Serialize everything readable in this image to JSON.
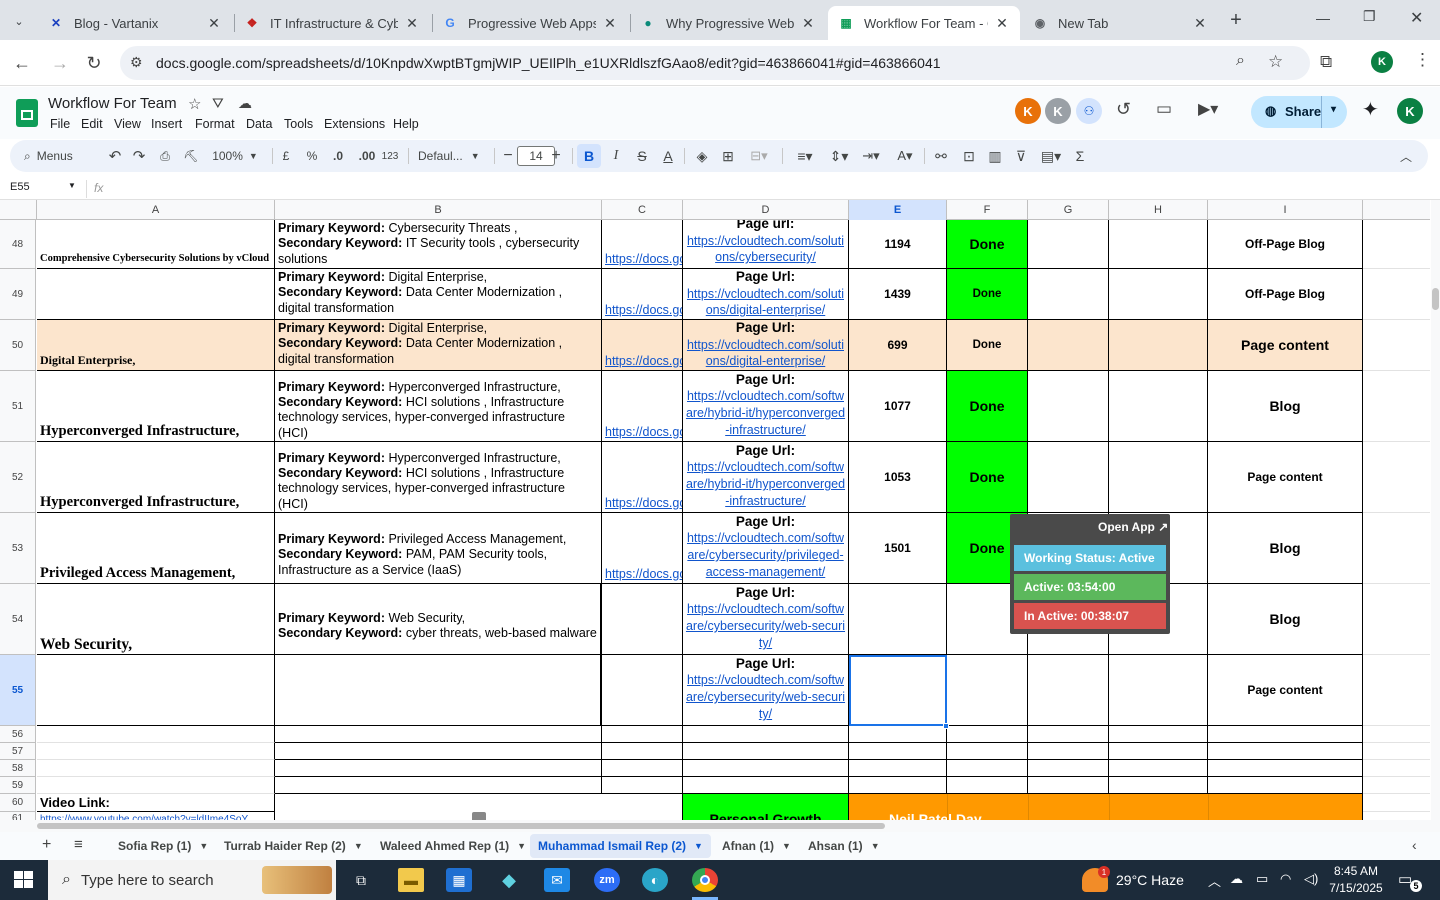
{
  "browser": {
    "tabs": [
      {
        "title": "Blog - Vartanix",
        "icon": "vartanix-x-icon",
        "color": "#1a3fbf",
        "glyph": "✕",
        "active": false
      },
      {
        "title": "IT Infrastructure & Cybe",
        "icon": "site-icon",
        "color": "#c5221f",
        "glyph": "❖",
        "active": false
      },
      {
        "title": "Progressive Web Apps (",
        "icon": "google-icon",
        "color": "#4285f4",
        "glyph": "G",
        "active": false
      },
      {
        "title": "Why Progressive Web A",
        "icon": "site-icon",
        "color": "#0b8b7a",
        "glyph": "●",
        "active": false
      },
      {
        "title": "Workflow For Team - Go",
        "icon": "sheets-icon",
        "color": "#0f9d58",
        "glyph": "▦",
        "active": true
      },
      {
        "title": "New Tab",
        "icon": "chrome-icon",
        "color": "#5f6368",
        "glyph": "◉",
        "active": false
      }
    ],
    "url": "docs.google.com/spreadsheets/d/10KnpdwXwptBTgmjWIP_UEIlPlh_e1UXRldlszfGAao8/edit?gid=463866041#gid=463866041"
  },
  "sheets": {
    "title": "Workflow For Team",
    "menus": [
      "File",
      "Edit",
      "View",
      "Insert",
      "Format",
      "Data",
      "Tools",
      "Extensions",
      "Help"
    ],
    "share_label": "Share",
    "avatars": [
      {
        "letter": "K",
        "color": "#e8710a"
      },
      {
        "letter": "K",
        "color": "#9aa0a6"
      },
      {
        "letter": "K",
        "color": "#0b8043"
      }
    ],
    "toolbar": {
      "menus_label": "Menus",
      "zoom": "100%",
      "currency": "£",
      "percent": "%",
      "dec_less": ".0",
      "dec_more": ".00",
      "num_format": "123",
      "font": "Defaul...",
      "font_size": "14"
    },
    "name_box": "E55",
    "fx": "fx"
  },
  "columns": [
    "A",
    "B",
    "C",
    "D",
    "E",
    "F",
    "G",
    "H",
    "I"
  ],
  "rows": [
    {
      "num": "48",
      "a": "Comprehensive Cybersecurity Solutions by vCloud",
      "b_primary": "Cybersecurity Threats ,",
      "b_secondary": " IT Security tools , cybersecurity solutions",
      "c": "https://docs.go",
      "d_label": "Page url:",
      "d_link": "https://vcloudtech.com/solutions/cybersecurity/",
      "e": "1194",
      "f": "Done",
      "i": "Off-Page Blog"
    },
    {
      "num": "49",
      "a": "",
      "b_primary": "Digital Enterprise,",
      "b_secondary": "Data Center Modernization , digital transformation",
      "c": "https://docs.go",
      "d_label": "Page Url:",
      "d_link": "https://vcloudtech.com/solutions/digital-enterprise/",
      "e": "1439",
      "f": "Done",
      "i": "Off-Page Blog"
    },
    {
      "num": "50",
      "a": "Digital Enterprise,",
      "b_primary": "Digital Enterprise,",
      "b_secondary": "Data Center Modernization , digital transformation",
      "c": "https://docs.go",
      "d_label": "Page Url:",
      "d_link": "https://vcloudtech.com/solutions/digital-enterprise/",
      "e": "699",
      "f": "Done",
      "i": "Page content"
    },
    {
      "num": "51",
      "a": "Hyperconverged Infrastructure,",
      "b_primary": "Hyperconverged Infrastructure,",
      "b_secondary": "HCI solutions , Infrastructure technology services, hyper-converged infrastructure (HCI)",
      "c": "https://docs.go",
      "d_label": "Page Url:",
      "d_link": "https://vcloudtech.com/software/hybrid-it/hyperconverged-infrastructure/",
      "e": "1077",
      "f": "Done",
      "i": "Blog"
    },
    {
      "num": "52",
      "a": "Hyperconverged Infrastructure,",
      "b_primary": "Hyperconverged Infrastructure,",
      "b_secondary": "HCI solutions , Infrastructure technology services, hyper-converged infrastructure (HCI)",
      "c": "https://docs.go",
      "d_label": "Page Url:",
      "d_link": "https://vcloudtech.com/software/hybrid-it/hyperconverged-infrastructure/",
      "e": "1053",
      "f": "Done",
      "i": "Page content"
    },
    {
      "num": "53",
      "a": "Privileged Access Management,",
      "b_primary": "Privileged Access Management,",
      "b_secondary": "PAM, PAM Security tools, Infrastructure as a Service (IaaS)",
      "c": "https://docs.go",
      "d_label": "Page Url:",
      "d_link": "https://vcloudtech.com/software/cybersecurity/privileged-access-management/",
      "e": "1501",
      "f": "Done",
      "i": "Blog"
    },
    {
      "num": "54",
      "a": "Web Security,",
      "b_primary": "Web Security,",
      "b_secondary": "cyber threats, web-based malware",
      "c": "",
      "d_label": "Page Url:",
      "d_link": "https://vcloudtech.com/software/cybersecurity/web-security/",
      "e": "",
      "f": "",
      "i": "Blog"
    },
    {
      "num": "55",
      "a": "",
      "b_primary": "",
      "b_secondary": "",
      "c": "",
      "d_label": "Page Url:",
      "d_link": "https://vcloudtech.com/software/cybersecurity/web-security/",
      "e": "",
      "f": "",
      "i": "Page content"
    }
  ],
  "labels": {
    "primary": "Primary Keyword:",
    "secondary": "Secondary Keyword:"
  },
  "small_rows": [
    "56",
    "57",
    "58",
    "59"
  ],
  "row60": {
    "num": "60",
    "a": "Video Link:",
    "d": "Personal Growth",
    "e": "Neil Patel Day"
  },
  "row61": {
    "num": "61",
    "a": "https://www.youtube.com/watch?v=ldIIme4SoY"
  },
  "widget": {
    "open_app": "Open App ↗",
    "status": "Working Status: Active",
    "active": "Active: 03:54:00",
    "inactive": "In Active: 00:38:07",
    "status_color": "#5bc0de",
    "active_color": "#5cb85c",
    "inactive_color": "#d9534f"
  },
  "sheet_tabs": [
    "Sofia Rep (1)",
    "Turrab Haider Rep (2)",
    "Waleed Ahmed Rep (1)",
    "Muhammad Ismail Rep (2)",
    "Afnan (1)",
    "Ahsan (1)"
  ],
  "active_sheet": "Muhammad Ismail Rep (2)",
  "taskbar": {
    "search_placeholder": "Type here to search",
    "weather": "29°C  Haze",
    "weather_badge": "1",
    "time": "8:45 AM",
    "date": "7/15/2025",
    "notifications": "5"
  }
}
